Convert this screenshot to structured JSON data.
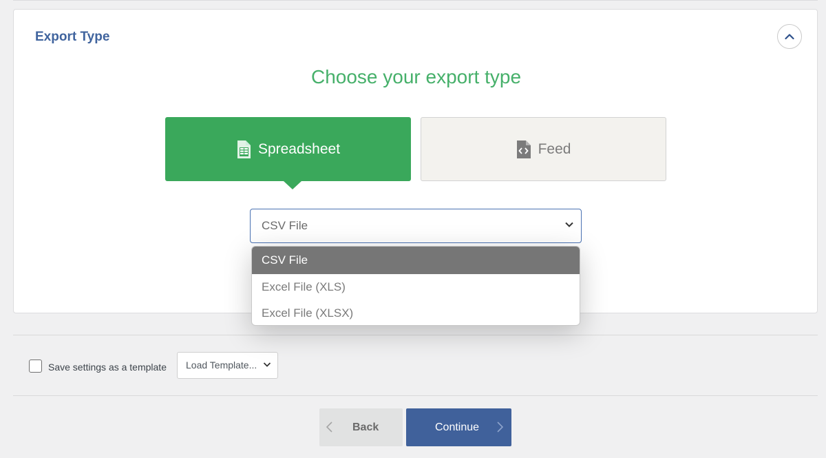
{
  "panel": {
    "title": "Export Type",
    "heading": "Choose your export type"
  },
  "export_types": [
    {
      "label": "Spreadsheet",
      "icon": "spreadsheet-icon",
      "active": true
    },
    {
      "label": "Feed",
      "icon": "code-file-icon",
      "active": false
    }
  ],
  "format_select": {
    "value": "CSV File",
    "options": [
      "CSV File",
      "Excel File (XLS)",
      "Excel File (XLSX)"
    ],
    "selected_index": 0
  },
  "footer": {
    "save_template_label": "Save settings as a template",
    "load_template_label": "Load Template...",
    "back_label": "Back",
    "continue_label": "Continue"
  },
  "colors": {
    "accent_green": "#3aa85b",
    "title_blue": "#40649e",
    "primary_button": "#40619b"
  }
}
